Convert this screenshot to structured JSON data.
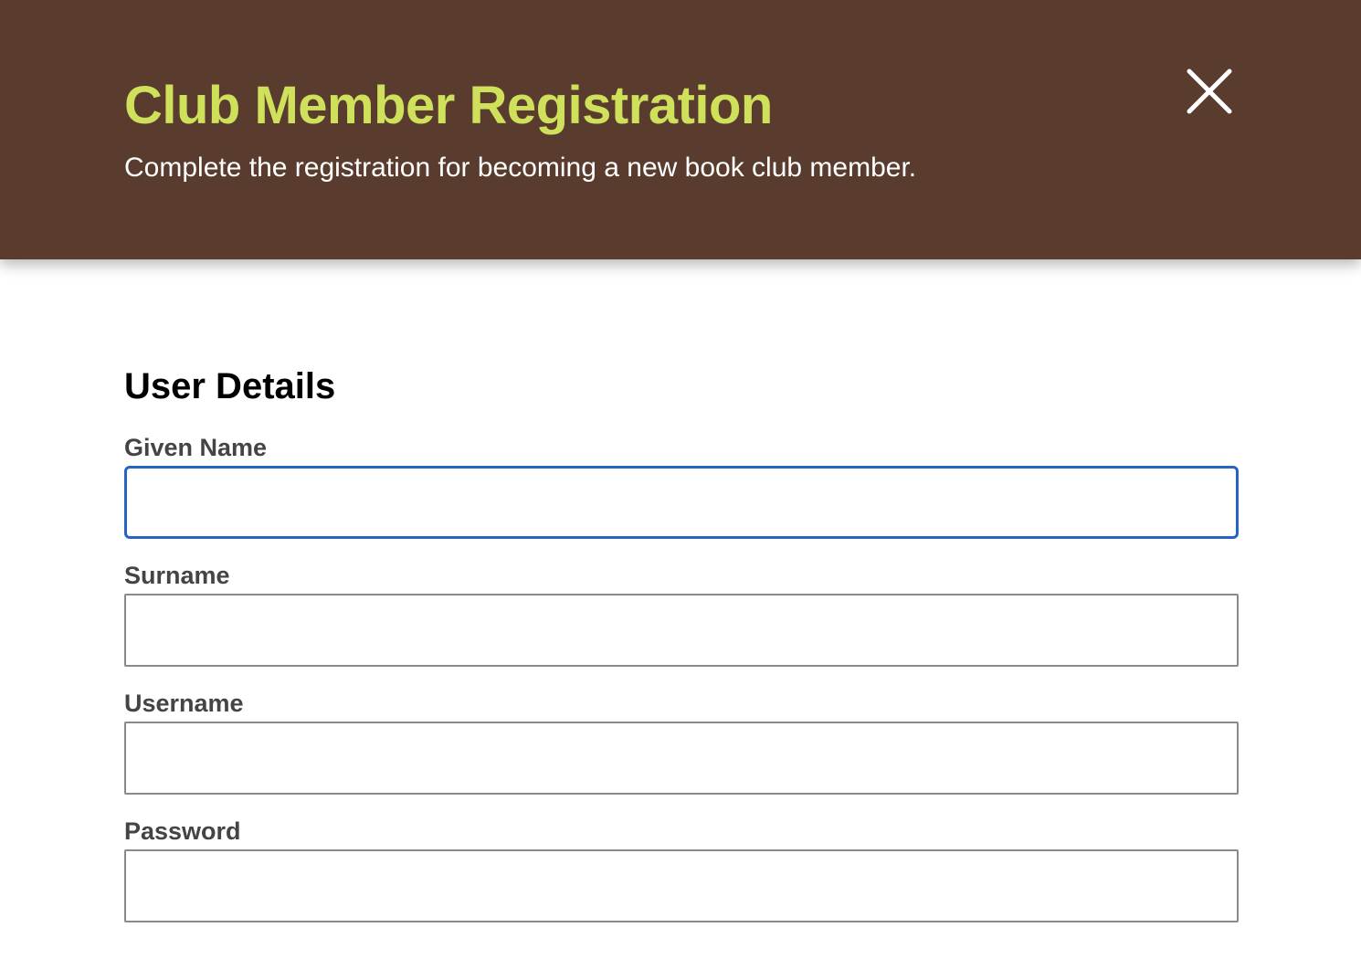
{
  "header": {
    "title": "Club Member Registration",
    "subtitle": "Complete the registration for becoming a new book club member.",
    "close_icon": "close-icon"
  },
  "colors": {
    "header_bg": "#5a3c2f",
    "title": "#cfe05a",
    "focus_border": "#2563c5"
  },
  "form": {
    "section_title": "User Details",
    "fields": [
      {
        "label": "Given Name",
        "value": "",
        "placeholder": "",
        "focused": true
      },
      {
        "label": "Surname",
        "value": "",
        "placeholder": ""
      },
      {
        "label": "Username",
        "value": "",
        "placeholder": ""
      },
      {
        "label": "Password",
        "value": "",
        "placeholder": ""
      }
    ]
  }
}
